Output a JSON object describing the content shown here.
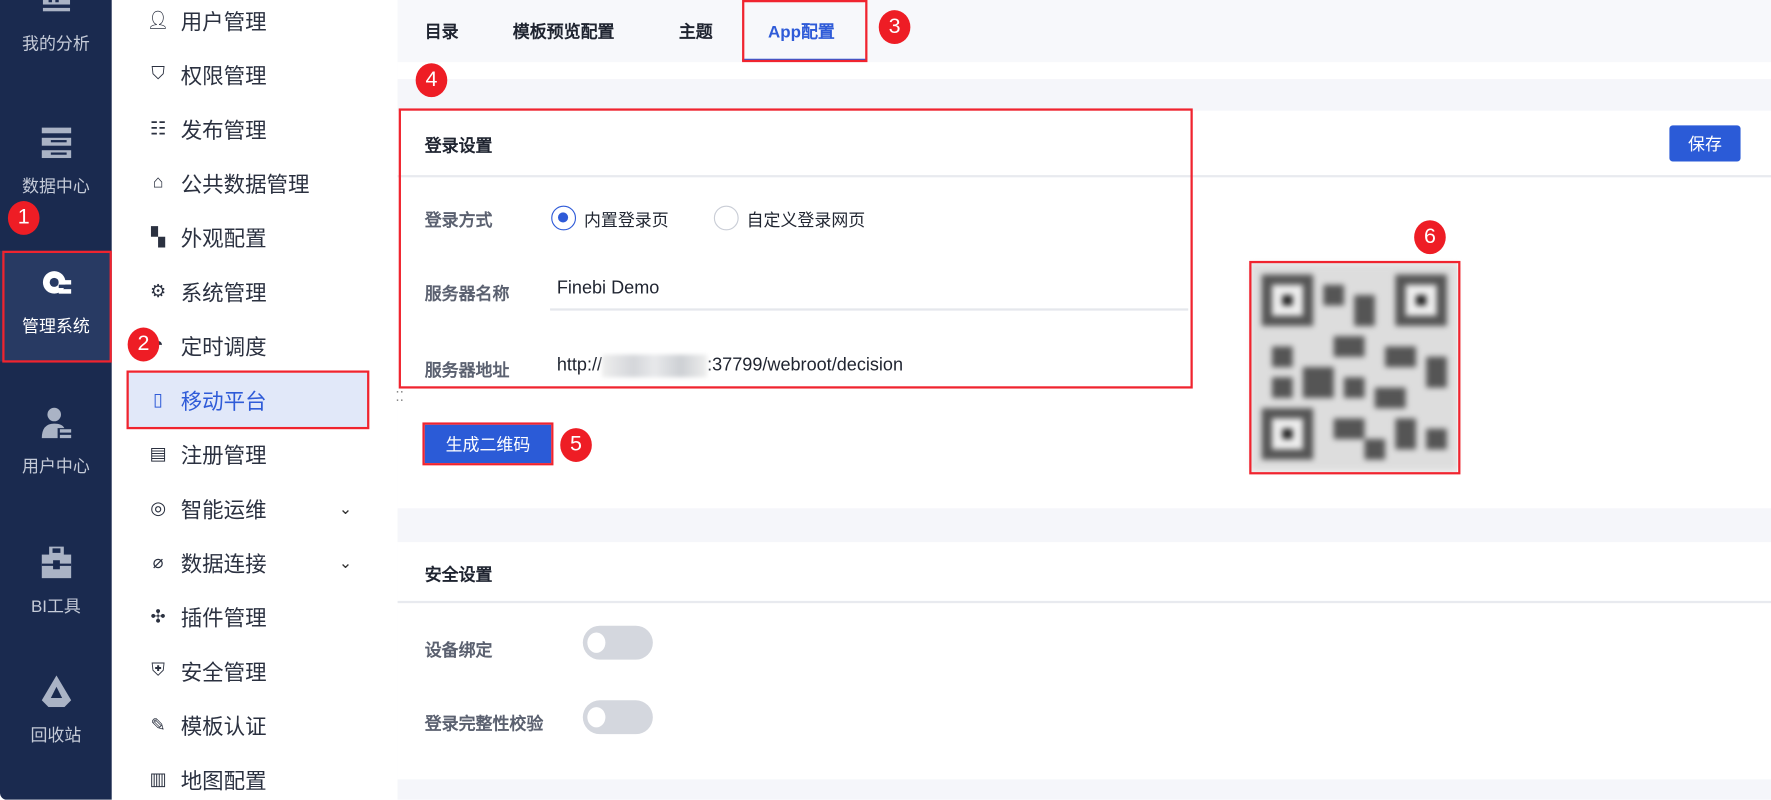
{
  "nav": {
    "items": [
      {
        "label": "我的分析",
        "icon": "analysis-icon"
      },
      {
        "label": "数据中心",
        "icon": "database-icon"
      },
      {
        "label": "管理系统",
        "icon": "settings-gear-icon",
        "active": true
      },
      {
        "label": "用户中心",
        "icon": "user-center-icon"
      },
      {
        "label": "BI工具",
        "icon": "toolbox-icon"
      },
      {
        "label": "回收站",
        "icon": "recycle-icon"
      }
    ]
  },
  "menu": {
    "items": [
      {
        "label": "用户管理"
      },
      {
        "label": "权限管理"
      },
      {
        "label": "发布管理"
      },
      {
        "label": "公共数据管理"
      },
      {
        "label": "外观配置"
      },
      {
        "label": "系统管理"
      },
      {
        "label": "定时调度"
      },
      {
        "label": "移动平台",
        "active": true
      },
      {
        "label": "注册管理"
      },
      {
        "label": "智能运维",
        "expandable": true
      },
      {
        "label": "数据连接",
        "expandable": true
      },
      {
        "label": "插件管理"
      },
      {
        "label": "安全管理"
      },
      {
        "label": "模板认证"
      },
      {
        "label": "地图配置"
      }
    ]
  },
  "tabs": [
    {
      "label": "目录"
    },
    {
      "label": "模板预览配置"
    },
    {
      "label": "主题"
    },
    {
      "label": "App配置",
      "active": true
    }
  ],
  "login_settings": {
    "title": "登录设置",
    "save_label": "保存",
    "login_method_label": "登录方式",
    "login_options": [
      "内置登录页",
      "自定义登录网页"
    ],
    "selected_option": "内置登录页",
    "server_name_label": "服务器名称",
    "server_name_value": "Finebi Demo",
    "server_address_label": "服务器地址",
    "server_address_prefix": "http://",
    "server_address_suffix": ":37799/webroot/decision",
    "generate_qr_label": "生成二维码"
  },
  "security_settings": {
    "title": "安全设置",
    "device_binding_label": "设备绑定",
    "device_binding_on": false,
    "login_integrity_label": "登录完整性校验",
    "login_integrity_on": false
  },
  "annotations": [
    "1",
    "2",
    "3",
    "4",
    "5",
    "6"
  ],
  "colors": {
    "nav_bg": "#1a2a4f",
    "accent": "#2b5bd7",
    "annotation": "#ee1d25"
  }
}
